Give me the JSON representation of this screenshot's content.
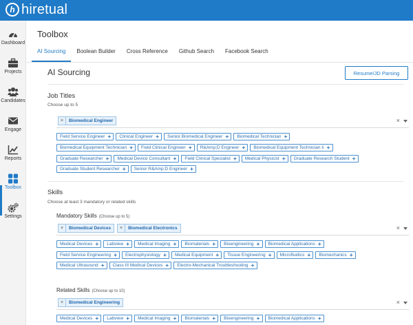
{
  "brand": {
    "logo_mark": "h",
    "name": "hiretual"
  },
  "sidebar": {
    "items": [
      {
        "label": "Dashboard",
        "icon": "dashboard-icon"
      },
      {
        "label": "Projects",
        "icon": "briefcase-icon"
      },
      {
        "label": "Candidates",
        "icon": "users-icon"
      },
      {
        "label": "Engage",
        "icon": "envelope-icon"
      },
      {
        "label": "Reports",
        "icon": "chart-line-icon"
      },
      {
        "label": "Toolbox",
        "icon": "grid-icon",
        "active": true
      },
      {
        "label": "Settings",
        "icon": "gears-icon"
      }
    ]
  },
  "header": {
    "title": "Toolbox"
  },
  "tabs": [
    {
      "label": "AI Sourcing",
      "active": true
    },
    {
      "label": "Boolean Builder"
    },
    {
      "label": "Cross Reference"
    },
    {
      "label": "Github Search"
    },
    {
      "label": "Facebook Search"
    }
  ],
  "ai_sourcing": {
    "title": "AI Sourcing",
    "resume_button": "Resume/JD Parsing",
    "job_titles": {
      "label": "Job Titles",
      "hint": "Choose up to 5",
      "selected": [
        "Biomedical Engineer"
      ],
      "clear": "×",
      "suggestions": [
        [
          "Field Service Engineer",
          "Clinical Engineer",
          "Senior Biomedical Engineer",
          "Biomedical Technician"
        ],
        [
          "Biomedical Equipment Technician",
          "Field Clinical Engineer",
          "R&Amp;D Engineer",
          "Biomedical Equipment Technician Ii"
        ],
        [
          "Graduate Researcher",
          "Medical Device Consultant",
          "Field Clinical Specialist",
          "Medical Physicist",
          "Graduate Research Student"
        ],
        [
          "Graduate Student Researcher",
          "Senior R&Amp;D Engineer"
        ]
      ]
    },
    "skills": {
      "label": "Skills",
      "hint": "Choose at least 3 mandatory or related skills",
      "mandatory": {
        "label": "Mandatory Skills",
        "hint": "(Choose up to 5)",
        "selected": [
          "Biomedical Devices",
          "Biomedical Electronics"
        ],
        "clear": "×",
        "suggestions": [
          [
            "Medical Devices",
            "Labview",
            "Medical Imaging",
            "Biomaterials",
            "Bioengineering",
            "Biomedical Applications"
          ],
          [
            "Field Service Engineering",
            "Electrophysiology",
            "Medical Equipment",
            "Tissue Engineering",
            "Microfluidics",
            "Biomechanics"
          ],
          [
            "Medical Ultrasound",
            "Class III Medical Devices",
            "Electro-Mechanical Troubleshooting"
          ]
        ]
      },
      "related": {
        "label": "Related Skills",
        "hint": "(Choose up to 10)",
        "selected": [
          "Biomedical Engineering"
        ],
        "clear": "×",
        "suggestions": [
          [
            "Medical Devices",
            "Labview",
            "Medical Imaging",
            "Biomaterials",
            "Bioengineering",
            "Biomedical Applications"
          ]
        ]
      }
    }
  },
  "colors": {
    "brand": "#1f7ac7",
    "chip_border": "#4a90cf",
    "chip_text": "#2b6fb0",
    "selected_bg": "#e7f1fa"
  }
}
